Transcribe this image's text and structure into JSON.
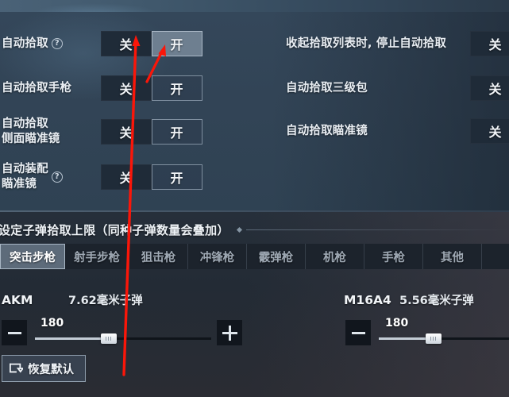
{
  "settings": {
    "left_rows": [
      {
        "label": "自动拾取",
        "has_help": true,
        "options": [
          {
            "text": "关",
            "state": "off-state"
          },
          {
            "text": "开",
            "state": "on-state"
          }
        ]
      },
      {
        "label": "自动拾取手枪",
        "has_help": false,
        "options": [
          {
            "text": "关",
            "state": "off-state"
          },
          {
            "text": "开",
            "state": "on-state unsel"
          }
        ]
      },
      {
        "label": "自动拾取\n侧面瞄准镜",
        "has_help": false,
        "options": [
          {
            "text": "关",
            "state": "off-state"
          },
          {
            "text": "开",
            "state": "on-state unsel"
          }
        ]
      },
      {
        "label": "自动装配\n瞄准镜",
        "has_help": true,
        "options": [
          {
            "text": "关",
            "state": "off-state"
          },
          {
            "text": "开",
            "state": "on-state unsel"
          }
        ]
      }
    ],
    "right_rows": [
      {
        "label": "收起拾取列表时, 停止自动拾取",
        "option": {
          "text": "关",
          "state": "off-state"
        }
      },
      {
        "label": "自动拾取三级包",
        "option": {
          "text": "关",
          "state": "off-state"
        }
      },
      {
        "label": "自动拾取瞄准镜",
        "option": {
          "text": "关",
          "state": "off-state"
        }
      }
    ]
  },
  "ammo_section": {
    "title": "设定子弹拾取上限（同种子弹数量会叠加）",
    "tabs": [
      {
        "label": "突击步枪",
        "selected": true
      },
      {
        "label": "射手步枪",
        "selected": false
      },
      {
        "label": "狙击枪",
        "selected": false
      },
      {
        "label": "冲锋枪",
        "selected": false
      },
      {
        "label": "霰弹枪",
        "selected": false
      },
      {
        "label": "机枪",
        "selected": false
      },
      {
        "label": "手枪",
        "selected": false
      },
      {
        "label": "其他",
        "selected": false
      }
    ],
    "weapons": [
      {
        "name": "AKM",
        "ammo_type": "7.62毫米子弹",
        "value": "180",
        "fill_percent": 42,
        "minus_label": "−",
        "plus_label": "+"
      },
      {
        "name": "M16A4",
        "ammo_type": "5.56毫米子弹",
        "value": "180",
        "fill_percent": 42,
        "minus_label": "−",
        "plus_label": "+"
      }
    ]
  },
  "restore": {
    "label": "恢复默认",
    "icon": "restore-loop-icon"
  },
  "annotations": {
    "arrow_color": "#fb1609",
    "arrow_long": "points from lower-left up to the 关 toggle of 自动拾取",
    "arrow_short": "points up-right to the 开 toggle of 自动拾取"
  },
  "colors": {
    "panel_top": "#34475a",
    "panel_bottom": "#262f3a",
    "toggle_off_bg": "#1f2b38",
    "toggle_on_bg": "#6e7f90",
    "tab_selected_bg": "#5d6b7a",
    "accent_red": "#fb1609"
  }
}
